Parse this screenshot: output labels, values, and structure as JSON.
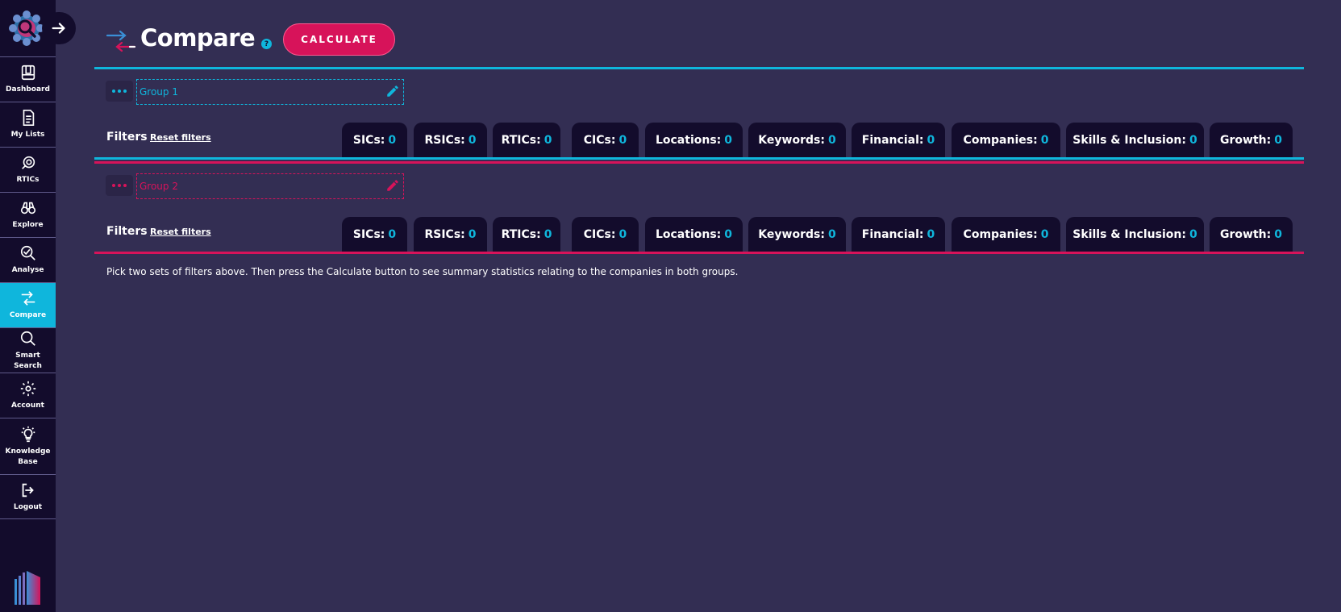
{
  "sidebar": {
    "items": [
      {
        "label": "Dashboard",
        "icon": "dashboard-icon"
      },
      {
        "label": "My Lists",
        "icon": "list-icon"
      },
      {
        "label": "RTICs",
        "icon": "rtics-icon"
      },
      {
        "label": "Explore",
        "icon": "binoculars-icon"
      },
      {
        "label": "Analyse",
        "icon": "analyse-icon"
      },
      {
        "label": "Compare",
        "icon": "compare-icon",
        "active": true
      },
      {
        "label": "Smart Search",
        "icon": "search-icon"
      },
      {
        "label": "Account",
        "icon": "gear-icon"
      },
      {
        "label": "Knowledge Base",
        "icon": "lightbulb-icon"
      },
      {
        "label": "Logout",
        "icon": "logout-icon"
      }
    ]
  },
  "header": {
    "title": "Compare",
    "help": "?",
    "calculate_label": "CALCULATE"
  },
  "groups": [
    {
      "name": "Group 1",
      "color": "#0fb6dc",
      "filters_label": "Filters",
      "reset_label": "Reset filters",
      "tabs": [
        {
          "label": "SICs:",
          "count": "0"
        },
        {
          "label": "RSICs:",
          "count": "0"
        },
        {
          "label": "RTICs:",
          "count": "0"
        },
        {
          "label": "CICs:",
          "count": "0"
        },
        {
          "label": "Locations:",
          "count": "0"
        },
        {
          "label": "Keywords:",
          "count": "0"
        },
        {
          "label": "Financial:",
          "count": "0"
        },
        {
          "label": "Companies:",
          "count": "0"
        },
        {
          "label": "Skills & Inclusion:",
          "count": "0"
        },
        {
          "label": "Growth:",
          "count": "0"
        }
      ]
    },
    {
      "name": "Group 2",
      "color": "#d7135a",
      "filters_label": "Filters",
      "reset_label": "Reset filters",
      "tabs": [
        {
          "label": "SICs:",
          "count": "0"
        },
        {
          "label": "RSICs:",
          "count": "0"
        },
        {
          "label": "RTICs:",
          "count": "0"
        },
        {
          "label": "CICs:",
          "count": "0"
        },
        {
          "label": "Locations:",
          "count": "0"
        },
        {
          "label": "Keywords:",
          "count": "0"
        },
        {
          "label": "Financial:",
          "count": "0"
        },
        {
          "label": "Companies:",
          "count": "0"
        },
        {
          "label": "Skills & Inclusion:",
          "count": "0"
        },
        {
          "label": "Growth:",
          "count": "0"
        }
      ]
    }
  ],
  "info_text": "Pick two sets of filters above. Then press the Calculate button to see summary statistics relating to the companies in both groups.",
  "colors": {
    "accent_cyan": "#0fb6dc",
    "accent_pink": "#d7135a",
    "sidebar_bg": "#130c2c",
    "page_bg": "#332e53"
  }
}
